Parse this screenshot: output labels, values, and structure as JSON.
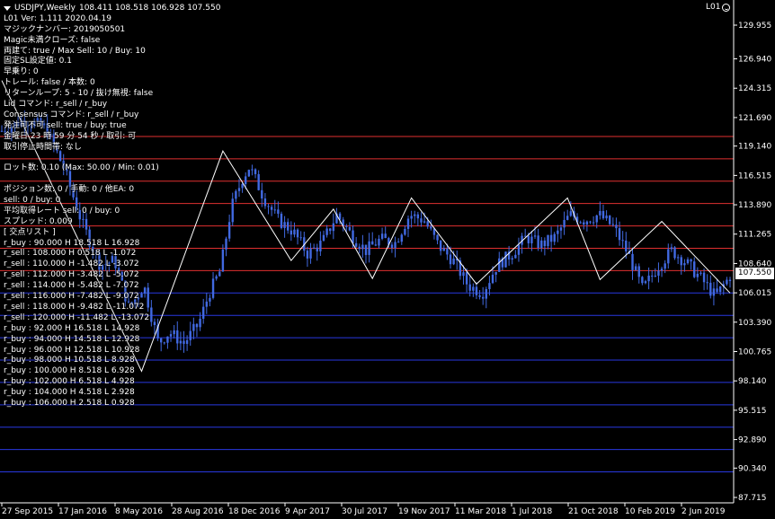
{
  "header": {
    "symbol_timeframe": "USDJPY,Weekly",
    "ohlc": "108.411 108.518 106.928 107.550",
    "ea_name": "L01"
  },
  "info_lines": [
    "L01 Ver: 1.111 2020.04.19",
    "マジックナンバー: 2019050501",
    "Magic未満クローズ: false",
    "両建て: true / Max Sell: 10 / Buy: 10",
    "固定SL設定値: 0.1",
    "早乗り: 0",
    "トレール: false / 本数: 0",
    "リターンループ: 5 - 10 / 抜け無視: false",
    "Lid コマンド: r_sell / r_buy",
    "Consensus コマンド: r_sell / r_buy",
    "発注可不可 sell: true / buy: true",
    "金曜日 23 時 59 分 54 秒 / 取引: 可",
    "取引停止時間帯: なし",
    "",
    "ロット数: 0.10 (Max: 50.00 / Min: 0.01)",
    "",
    "ポジション数: 0 / 手動: 0 / 他EA: 0",
    "sell: 0 / buy: 0",
    "平均取得レート sell: 0 / buy: 0",
    "スプレッド: 0.009",
    "[ 交点リスト ]",
    "r_buy : 90.000 H 18.518 L 16.928",
    "r_sell : 108.000 H 0.518 L -1.072",
    "r_sell : 110.000 H -1.482 L -3.072",
    "r_sell : 112.000 H -3.482 L -5.072",
    "r_sell : 114.000 H -5.482 L -7.072",
    "r_sell : 116.000 H -7.482 L -9.072",
    "r_sell : 118.000 H -9.482 L -11.072",
    "r_sell : 120.000 H -11.482 L -13.072",
    "r_buy : 92.000 H 16.518 L 14.928",
    "r_buy : 94.000 H 14.518 L 12.928",
    "r_buy : 96.000 H 12.518 L 10.928",
    "r_buy : 98.000 H 10.518 L 8.928",
    "r_buy : 100.000 H 8.518 L 6.928",
    "r_buy : 102.000 H 6.518 L 4.928",
    "r_buy : 104.000 H 4.518 L 2.928",
    "r_buy : 106.000 H 2.518 L 0.928"
  ],
  "current_price_label": "107.550",
  "colors": {
    "background": "#000000",
    "candle": "#4169E1",
    "sell_line": "#E03030",
    "buy_line": "#2838E0",
    "zigzag": "#FFFFFF",
    "axis_text": "#FFFFFF"
  },
  "chart_data": {
    "type": "candlestick",
    "title": "USDJPY,Weekly",
    "y_ticks": [
      129.955,
      126.94,
      124.315,
      121.69,
      119.14,
      116.515,
      113.89,
      111.265,
      108.64,
      106.015,
      103.39,
      100.765,
      98.14,
      95.515,
      92.89,
      90.34,
      87.715
    ],
    "y_tick_labels": [
      "129.955",
      "126.940",
      "124.315",
      "121.690",
      "119.140",
      "116.515",
      "113.890",
      "111.265",
      "108.640",
      "106.015",
      "103.390",
      "100.765",
      "98.140",
      "95.515",
      "92.890",
      "90.340",
      "87.715"
    ],
    "ylim": [
      87.0,
      131.0
    ],
    "x_tick_labels": [
      "27 Sep 2015",
      "17 Jan 2016",
      "8 May 2016",
      "28 Aug 2016",
      "18 Dec 2016",
      "9 Apr 2017",
      "30 Jul 2017",
      "19 Nov 2017",
      "11 Mar 2018",
      "1 Jul 2018",
      "21 Oct 2018",
      "10 Feb 2019",
      "2 Jun 2019"
    ],
    "horizontal_levels": {
      "sell": [
        108.0,
        110.0,
        112.0,
        114.0,
        116.0,
        118.0,
        120.0
      ],
      "buy": [
        90.0,
        92.0,
        94.0,
        96.0,
        98.0,
        100.0,
        102.0,
        104.0,
        106.0
      ]
    },
    "close_path": [
      [
        0,
        120.5
      ],
      [
        6,
        121.5
      ],
      [
        12,
        120.8
      ],
      [
        17,
        117.2
      ],
      [
        22,
        112.3
      ],
      [
        27,
        108.5
      ],
      [
        31,
        108.9
      ],
      [
        35,
        104.6
      ],
      [
        39,
        106.7
      ],
      [
        43,
        101.5
      ],
      [
        46,
        102.5
      ],
      [
        50,
        101.5
      ],
      [
        54,
        103.2
      ],
      [
        57,
        106.0
      ],
      [
        60,
        108.0
      ],
      [
        63,
        113.6
      ],
      [
        66,
        116.2
      ],
      [
        68,
        117.3
      ],
      [
        72,
        114.5
      ],
      [
        76,
        112.5
      ],
      [
        80,
        111.5
      ],
      [
        84,
        109.5
      ],
      [
        88,
        110.5
      ],
      [
        92,
        113.0
      ],
      [
        96,
        111.2
      ],
      [
        100,
        109.8
      ],
      [
        104,
        110.8
      ],
      [
        108,
        110.5
      ],
      [
        112,
        113.0
      ],
      [
        116,
        112.5
      ],
      [
        120,
        110.2
      ],
      [
        124,
        108.9
      ],
      [
        128,
        106.7
      ],
      [
        132,
        106.0
      ],
      [
        136,
        108.5
      ],
      [
        140,
        109.5
      ],
      [
        144,
        111.0
      ],
      [
        148,
        110.3
      ],
      [
        152,
        111.0
      ],
      [
        156,
        113.0
      ],
      [
        160,
        112.5
      ],
      [
        164,
        113.0
      ],
      [
        168,
        111.9
      ],
      [
        172,
        109.5
      ],
      [
        176,
        106.3
      ],
      [
        180,
        108.3
      ],
      [
        184,
        109.8
      ],
      [
        188,
        108.7
      ],
      [
        192,
        107.3
      ],
      [
        196,
        105.7
      ],
      [
        200,
        107.5
      ]
    ],
    "zigzag_points": [
      [
        0,
        125.0
      ],
      [
        43,
        99.0
      ],
      [
        68,
        118.7
      ],
      [
        89,
        108.9
      ],
      [
        102,
        113.5
      ],
      [
        114,
        107.3
      ],
      [
        126,
        114.5
      ],
      [
        146,
        106.8
      ],
      [
        174,
        114.5
      ],
      [
        184,
        107.2
      ],
      [
        203,
        112.4
      ],
      [
        224,
        106.0
      ]
    ],
    "x_count": 225
  }
}
